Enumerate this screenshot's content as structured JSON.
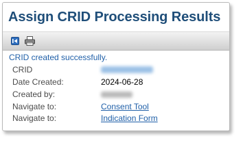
{
  "header": {
    "title": "Assign CRID Processing Results"
  },
  "toolbar": {
    "buttons": [
      {
        "icon": "back-icon"
      },
      {
        "icon": "print-icon"
      }
    ]
  },
  "status": {
    "message": "CRID created successfully."
  },
  "details": {
    "crid": {
      "label": "CRID"
    },
    "date_created": {
      "label": "Date Created:",
      "value": "2024-06-28"
    },
    "created_by": {
      "label": "Created by:"
    },
    "nav1": {
      "label": "Navigate to:",
      "link": "Consent Tool"
    },
    "nav2": {
      "label": "Navigate to:",
      "link": "Indication Form"
    }
  },
  "colors": {
    "title": "#1f4e79",
    "link": "#1f5fa8",
    "message": "#1f5fa8"
  }
}
